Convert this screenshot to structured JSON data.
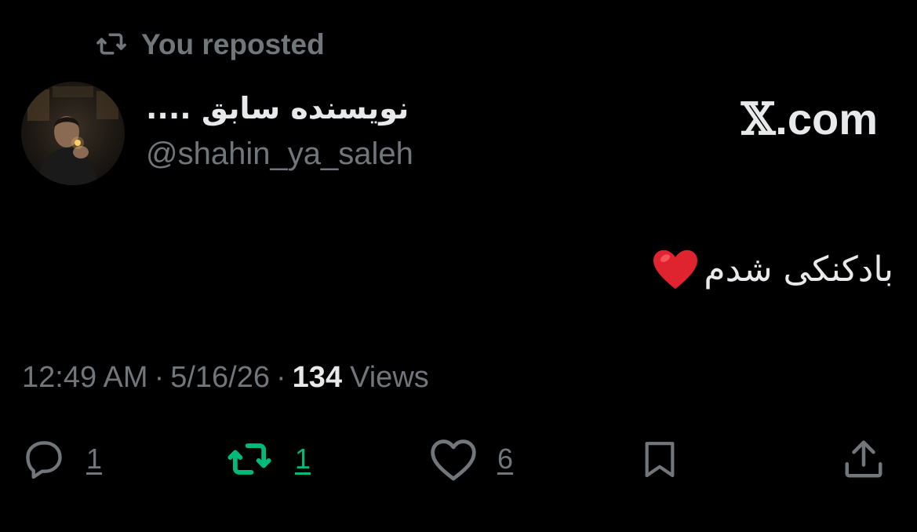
{
  "repost_header": {
    "icon": "repost-icon",
    "text": "You reposted"
  },
  "author": {
    "display_name": "نویسنده سابق ....",
    "handle": "@shahin_ya_saleh",
    "avatar": "avatar-photo"
  },
  "brand": {
    "x_glyph": "𝕏",
    "suffix": ".com"
  },
  "tweet": {
    "text": "بادکنکی شدم",
    "emoji": "heart-emoji"
  },
  "meta": {
    "time": "12:49 AM",
    "separator": "·",
    "date": "5/16/26",
    "views_count": "134",
    "views_label": "Views"
  },
  "actions": {
    "reply": {
      "icon": "reply-icon",
      "count": "1"
    },
    "repost": {
      "icon": "repost-icon",
      "count": "1",
      "active": true
    },
    "like": {
      "icon": "heart-icon",
      "count": "6"
    },
    "bookmark": {
      "icon": "bookmark-icon"
    },
    "share": {
      "icon": "share-icon"
    }
  },
  "colors": {
    "background": "#000000",
    "text_primary": "#e7e9ea",
    "text_secondary": "#71767b",
    "repost_active": "#00ba7c",
    "heart_emoji": "#e0242f"
  }
}
